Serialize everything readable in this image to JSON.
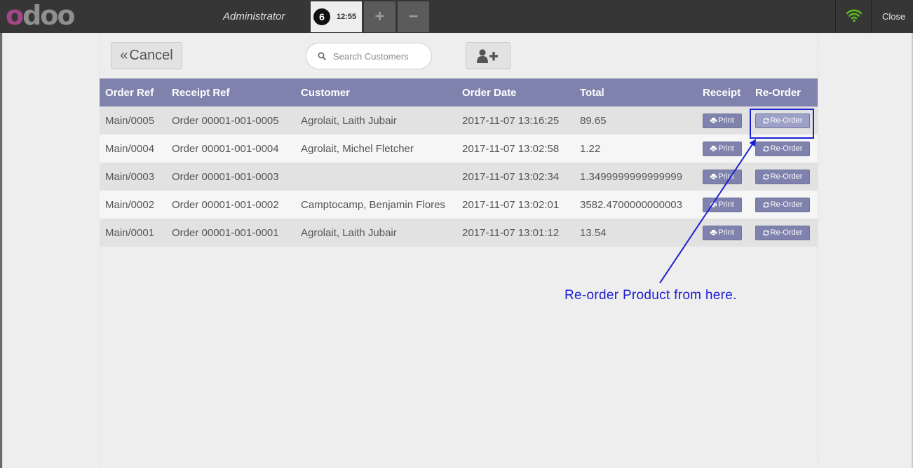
{
  "topbar": {
    "logo": {
      "first": "o",
      "rest": "doo"
    },
    "user": "Administrator",
    "order": {
      "number": "6",
      "time": "12:55"
    },
    "add_label": "+",
    "remove_label": "−",
    "close_label": "Close"
  },
  "controls": {
    "cancel_label": "Cancel",
    "search_placeholder": "Search Customers"
  },
  "table": {
    "headers": {
      "order_ref": "Order Ref",
      "receipt_ref": "Receipt Ref",
      "customer": "Customer",
      "order_date": "Order Date",
      "total": "Total",
      "receipt": "Receipt",
      "reorder": "Re-Order"
    },
    "print_label": "Print",
    "reorder_label": "Re-Order",
    "rows": [
      {
        "order_ref": "Main/0005",
        "receipt_ref": "Order 00001-001-0005",
        "customer": "Agrolait, Laith Jubair",
        "order_date": "2017-11-07 13:16:25",
        "total": "89.65"
      },
      {
        "order_ref": "Main/0004",
        "receipt_ref": "Order 00001-001-0004",
        "customer": "Agrolait, Michel Fletcher",
        "order_date": "2017-11-07 13:02:58",
        "total": "1.22"
      },
      {
        "order_ref": "Main/0003",
        "receipt_ref": "Order 00001-001-0003",
        "customer": "",
        "order_date": "2017-11-07 13:02:34",
        "total": "1.3499999999999999"
      },
      {
        "order_ref": "Main/0002",
        "receipt_ref": "Order 00001-001-0002",
        "customer": "Camptocamp, Benjamin Flores",
        "order_date": "2017-11-07 13:02:01",
        "total": "3582.4700000000003"
      },
      {
        "order_ref": "Main/0001",
        "receipt_ref": "Order 00001-001-0001",
        "customer": "Agrolait, Laith Jubair",
        "order_date": "2017-11-07 13:01:12",
        "total": "13.54"
      }
    ]
  },
  "annotation": {
    "text": "Re-order Product from here.",
    "color": "#1a1fd3"
  },
  "colors": {
    "header": "#7f82ac",
    "topbar": "#363636",
    "wifi": "#5cb81e"
  }
}
